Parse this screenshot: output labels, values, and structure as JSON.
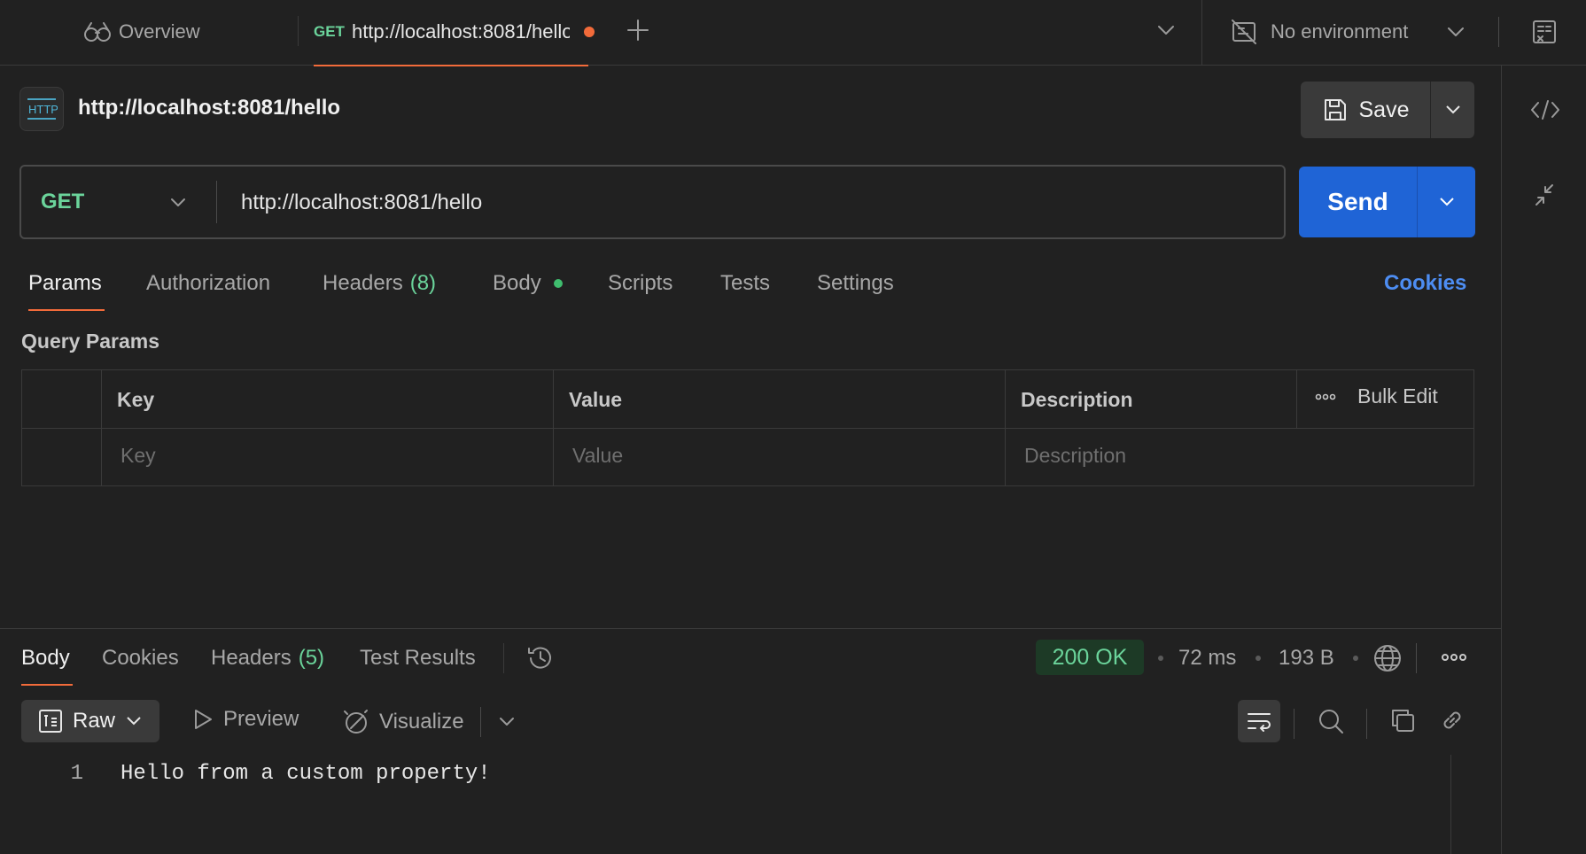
{
  "top_tabs": {
    "overview_label": "Overview",
    "active_tab": {
      "method": "GET",
      "url": "http://localhost:8081/hello",
      "unsaved": true
    },
    "environment": "No environment"
  },
  "request": {
    "title": "http://localhost:8081/hello",
    "save_label": "Save",
    "method": "GET",
    "url": "http://localhost:8081/hello",
    "send_label": "Send",
    "tabs": [
      {
        "label": "Params",
        "active": true
      },
      {
        "label": "Authorization"
      },
      {
        "label": "Headers",
        "count": "(8)"
      },
      {
        "label": "Body",
        "dot": true
      },
      {
        "label": "Scripts"
      },
      {
        "label": "Tests"
      },
      {
        "label": "Settings"
      }
    ],
    "cookies_label": "Cookies",
    "query_params": {
      "title": "Query Params",
      "columns": {
        "key": "Key",
        "value": "Value",
        "description": "Description"
      },
      "bulk_edit_label": "Bulk Edit",
      "placeholders": {
        "key": "Key",
        "value": "Value",
        "description": "Description"
      }
    }
  },
  "response": {
    "tabs": [
      {
        "label": "Body",
        "active": true
      },
      {
        "label": "Cookies"
      },
      {
        "label": "Headers",
        "count": "(5)"
      },
      {
        "label": "Test Results"
      }
    ],
    "status": "200 OK",
    "time": "72 ms",
    "size": "193 B",
    "view": {
      "format_label": "Raw",
      "preview_label": "Preview",
      "visualize_label": "Visualize"
    },
    "body_lines": [
      {
        "n": "1",
        "text": "Hello from a custom property!"
      }
    ]
  },
  "colors": {
    "background": "#212121",
    "accent_orange": "#f26b3a",
    "method_green": "#6bd49b",
    "send_blue": "#1f64d6",
    "link_blue": "#4d8df2"
  },
  "icons": [
    "overview-icon",
    "plus-icon",
    "chevron-down-icon",
    "no-environment-icon",
    "variables-icon",
    "http-icon",
    "save-icon",
    "code-icon",
    "collapse-icon",
    "history-icon",
    "globe-icon",
    "more-icon",
    "raw-icon",
    "play-icon",
    "visualize-icon",
    "wrap-icon",
    "search-icon",
    "copy-icon",
    "link-icon"
  ]
}
